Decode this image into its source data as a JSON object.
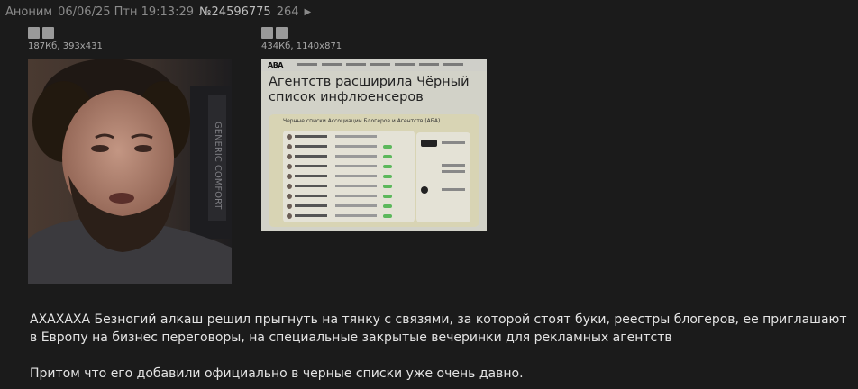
{
  "post": {
    "author": "Аноним",
    "datetime": "06/06/25 Птн 19:13:29",
    "number": "№24596775",
    "reply_count": "264"
  },
  "files": [
    {
      "meta": "187Кб, 393x431"
    },
    {
      "meta": "434Кб, 1140x871"
    }
  ],
  "thumb2": {
    "logo": "ABA",
    "title": "Агентств расширила Чёрный список инфлюенсеров",
    "panel_title": "Черные списки Ассоциации Блогеров и Агентств (АБА)"
  },
  "body": {
    "paragraphs": [
      "АХАХАХА Безногий алкаш решил прыгнуть на тянку с связями, за которой стоят буки, реестры блогеров, ее приглашают в Европу на бизнес переговоры, на специальные закрытые вечеринки для рекламных агентств",
      "Притом что его добавили официально в черные списки уже очень давно."
    ]
  },
  "colors": {
    "background": "#1b1b1b",
    "header_text": "#8a8a8a",
    "body_text": "#e4e4e4"
  }
}
